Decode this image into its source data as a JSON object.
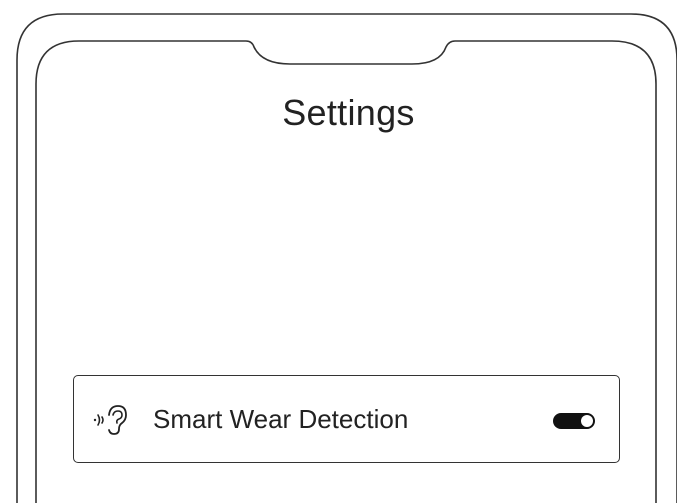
{
  "screen": {
    "title": "Settings"
  },
  "settings": [
    {
      "icon": "ear-sound-icon",
      "label": "Smart Wear Detection",
      "toggle_state": "on"
    }
  ],
  "colors": {
    "frame": "#333333",
    "text": "#222222",
    "toggle_track": "#111111",
    "toggle_knob": "#ffffff"
  }
}
